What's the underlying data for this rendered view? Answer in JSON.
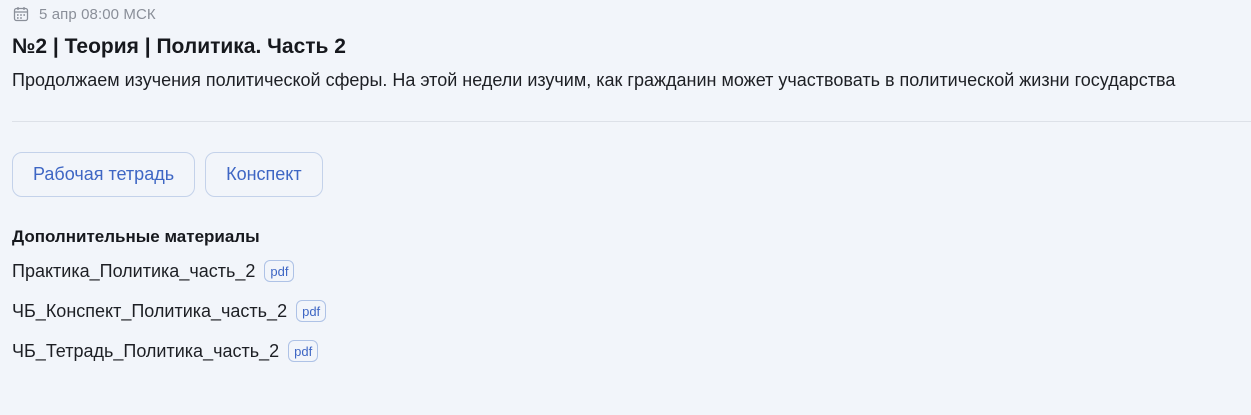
{
  "lesson": {
    "date_icon": "calendar-icon",
    "date": "5 апр 08:00 МСК",
    "title": "№2 | Теория | Политика. Часть 2",
    "description": "Продолжаем изучения политической сферы. На этой недели изучим, как гражданин может участвовать в политической жизни государства"
  },
  "buttons": {
    "workbook_label": "Рабочая тетрадь",
    "notes_label": "Конспект"
  },
  "extra_materials": {
    "heading": "Дополнительные материалы",
    "files": [
      {
        "name": "Практика_Политика_часть_2",
        "type": "pdf"
      },
      {
        "name": "ЧБ_Конспект_Политика_часть_2",
        "type": "pdf"
      },
      {
        "name": "ЧБ_Тетрадь_Политика_часть_2",
        "type": "pdf"
      }
    ]
  },
  "colors": {
    "background": "#f2f5fa",
    "accent": "#3e66c4",
    "muted_text": "#8a8f99"
  }
}
